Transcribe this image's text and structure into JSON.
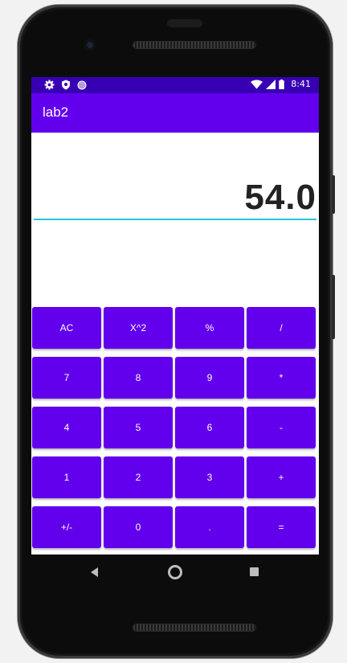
{
  "statusbar": {
    "time": "8:41",
    "icons": [
      "gear-icon",
      "shield-icon",
      "circle-icon",
      "wifi-icon",
      "signal-icon",
      "battery-icon"
    ]
  },
  "app": {
    "title": "lab2",
    "primary_color": "#6200ee",
    "dark_color": "#3700b3",
    "accent_color": "#26c6da"
  },
  "display": {
    "value": "54.0"
  },
  "keys": [
    [
      "AC",
      "X^2",
      "%",
      "/"
    ],
    [
      "7",
      "8",
      "9",
      "*"
    ],
    [
      "4",
      "5",
      "6",
      "-"
    ],
    [
      "1",
      "2",
      "3",
      "+"
    ],
    [
      "+/-",
      "0",
      ".",
      "="
    ]
  ]
}
